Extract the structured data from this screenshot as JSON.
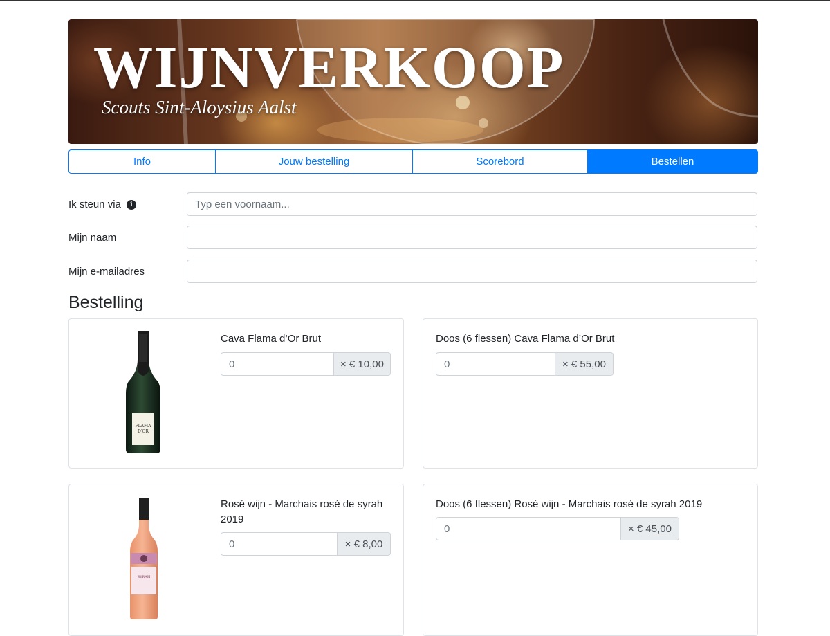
{
  "banner": {
    "title": "WIJNVERKOOP",
    "subtitle": "Scouts Sint-Aloysius Aalst"
  },
  "tabs": [
    {
      "label": "Info",
      "active": false
    },
    {
      "label": "Jouw bestelling",
      "active": false
    },
    {
      "label": "Scorebord",
      "active": false
    },
    {
      "label": "Bestellen",
      "active": true
    }
  ],
  "form": {
    "support_label": "Ik steun via",
    "support_placeholder": "Typ een voornaam...",
    "support_value": "",
    "name_label": "Mijn naam",
    "name_value": "",
    "email_label": "Mijn e-mailadres",
    "email_value": ""
  },
  "order": {
    "title": "Bestelling",
    "products": [
      {
        "name": "Cava Flama d’Or Brut",
        "quantity": "0",
        "price": "× € 10,00",
        "image": "cava-bottle"
      },
      {
        "name": "Doos (6 flessen) Cava Flama d’Or Brut",
        "quantity": "0",
        "price": "× € 55,00"
      },
      {
        "name": "Rosé wijn - Marchais rosé de syrah 2019",
        "quantity": "0",
        "price": "× € 8,00",
        "image": "rose-bottle"
      },
      {
        "name": "Doos (6 flessen) Rosé wijn - Marchais rosé de syrah 2019",
        "quantity": "0",
        "price": "× € 45,00"
      }
    ]
  },
  "colors": {
    "primary": "#007bff",
    "border": "#ced4da",
    "addon_bg": "#e9ecef",
    "text": "#212529"
  },
  "icons": {
    "info": "info-circle-icon"
  }
}
